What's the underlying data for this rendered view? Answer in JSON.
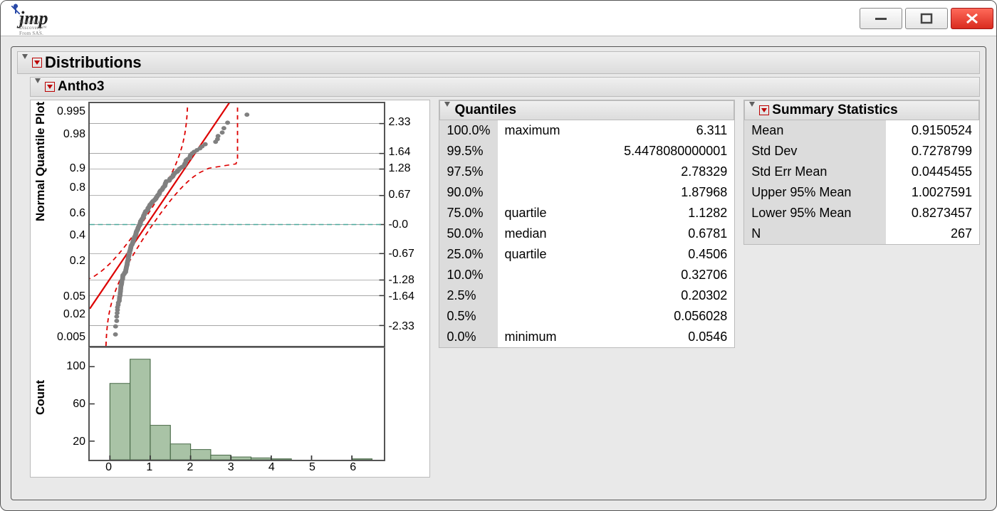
{
  "titles": {
    "distributions": "Distributions",
    "variable": "Antho3",
    "quantiles": "Quantiles",
    "summary": "Summary Statistics",
    "qq_ylabel": "Normal Quantile Plot",
    "hist_ylabel": "Count"
  },
  "quantiles": [
    {
      "pct": "100.0%",
      "label": "maximum",
      "value": "6.311"
    },
    {
      "pct": "99.5%",
      "label": "",
      "value": "5.4478080000001"
    },
    {
      "pct": "97.5%",
      "label": "",
      "value": "2.78329"
    },
    {
      "pct": "90.0%",
      "label": "",
      "value": "1.87968"
    },
    {
      "pct": "75.0%",
      "label": "quartile",
      "value": "1.1282"
    },
    {
      "pct": "50.0%",
      "label": "median",
      "value": "0.6781"
    },
    {
      "pct": "25.0%",
      "label": "quartile",
      "value": "0.4506"
    },
    {
      "pct": "10.0%",
      "label": "",
      "value": "0.32706"
    },
    {
      "pct": "2.5%",
      "label": "",
      "value": "0.20302"
    },
    {
      "pct": "0.5%",
      "label": "",
      "value": "0.056028"
    },
    {
      "pct": "0.0%",
      "label": "minimum",
      "value": "0.0546"
    }
  ],
  "summary": [
    {
      "label": "Mean",
      "value": "0.9150524"
    },
    {
      "label": "Std Dev",
      "value": "0.7278799"
    },
    {
      "label": "Std Err Mean",
      "value": "0.0445455"
    },
    {
      "label": "Upper 95% Mean",
      "value": "1.0027591"
    },
    {
      "label": "Lower 95% Mean",
      "value": "0.8273457"
    },
    {
      "label": "N",
      "value": "267"
    }
  ],
  "chart_data": [
    {
      "type": "scatter",
      "title": "Normal Quantile Plot",
      "xlabel": "Antho3",
      "ylabel": "Normal Quantile",
      "xlim": [
        -0.5,
        6.8
      ],
      "left_ticks": [
        0.005,
        0.02,
        0.05,
        0.2,
        0.4,
        0.6,
        0.8,
        0.9,
        0.98,
        0.995
      ],
      "right_ticks": [
        -2.33,
        -1.64,
        -1.28,
        -0.67,
        -0.0,
        0.67,
        1.28,
        1.64,
        2.33
      ],
      "reference_lines": {
        "fit": "solid red diagonal",
        "confidence": "dashed red Lilliefors bounds",
        "zero": "dashed teal horizontal at 0.0"
      },
      "points_note": "≈267 points forming right-skewed S-curve; bulk between x=0.05 and x=2, tail out to x≈4, one near x≈6.3"
    },
    {
      "type": "bar",
      "title": "Histogram",
      "xlabel": "Antho3",
      "ylabel": "Count",
      "xlim": [
        -0.5,
        6.8
      ],
      "ylim": [
        0,
        120
      ],
      "x_ticks": [
        0,
        1,
        2,
        3,
        4,
        5,
        6
      ],
      "y_ticks": [
        20,
        60,
        100
      ],
      "bin_width": 0.5,
      "bin_edges_start": 0.0,
      "values": [
        82,
        108,
        37,
        17,
        11,
        5,
        3,
        2,
        1,
        0,
        0,
        0,
        1
      ]
    }
  ]
}
